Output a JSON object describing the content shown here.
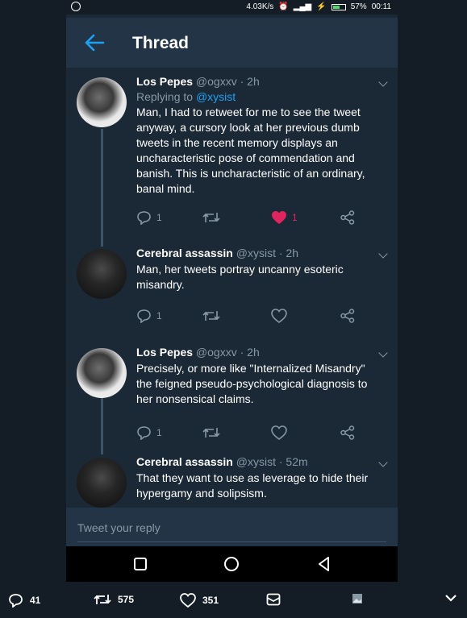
{
  "status_bar": {
    "speed": "4.03K/s",
    "battery": "57%",
    "time": "00:11"
  },
  "header": {
    "title": "Thread"
  },
  "tweets": [
    {
      "name": "Los Pepes",
      "handle": "@ogxxv",
      "time": "2h",
      "reply_prefix": "Replying to",
      "reply_handle": "@xysist",
      "text": "Man, I had to retweet for me to see the tweet anyway, a cursory look at her previous dumb tweets in the recent memory displays an uncharacteristic pose of commendation and banish. This is uncharacteristic of an ordinary, banal mind.",
      "replies": "1",
      "likes": "1"
    },
    {
      "name": "Cerebral assassin",
      "handle": "@xysist",
      "time": "2h",
      "text": "Man, her tweets portray uncanny esoteric misandry.",
      "replies": "1"
    },
    {
      "name": "Los Pepes",
      "handle": "@ogxxv",
      "time": "2h",
      "text": "Precisely, or more like \"Internalized Misandry\" the feigned pseudo-psychological diagnosis to her nonsensical claims.",
      "replies": "1"
    },
    {
      "name": "Cerebral assassin",
      "handle": "@xysist",
      "time": "52m",
      "text": "That they want to use as leverage to hide their hypergamy and solipsism."
    }
  ],
  "reply_box": {
    "placeholder": "Tweet your reply"
  },
  "bottom_bar": {
    "replies": "41",
    "retweets": "575",
    "likes": "351"
  },
  "colors": {
    "accent": "#1da1f2",
    "like": "#e0245e",
    "background": "#1b2836",
    "header": "#243447"
  }
}
